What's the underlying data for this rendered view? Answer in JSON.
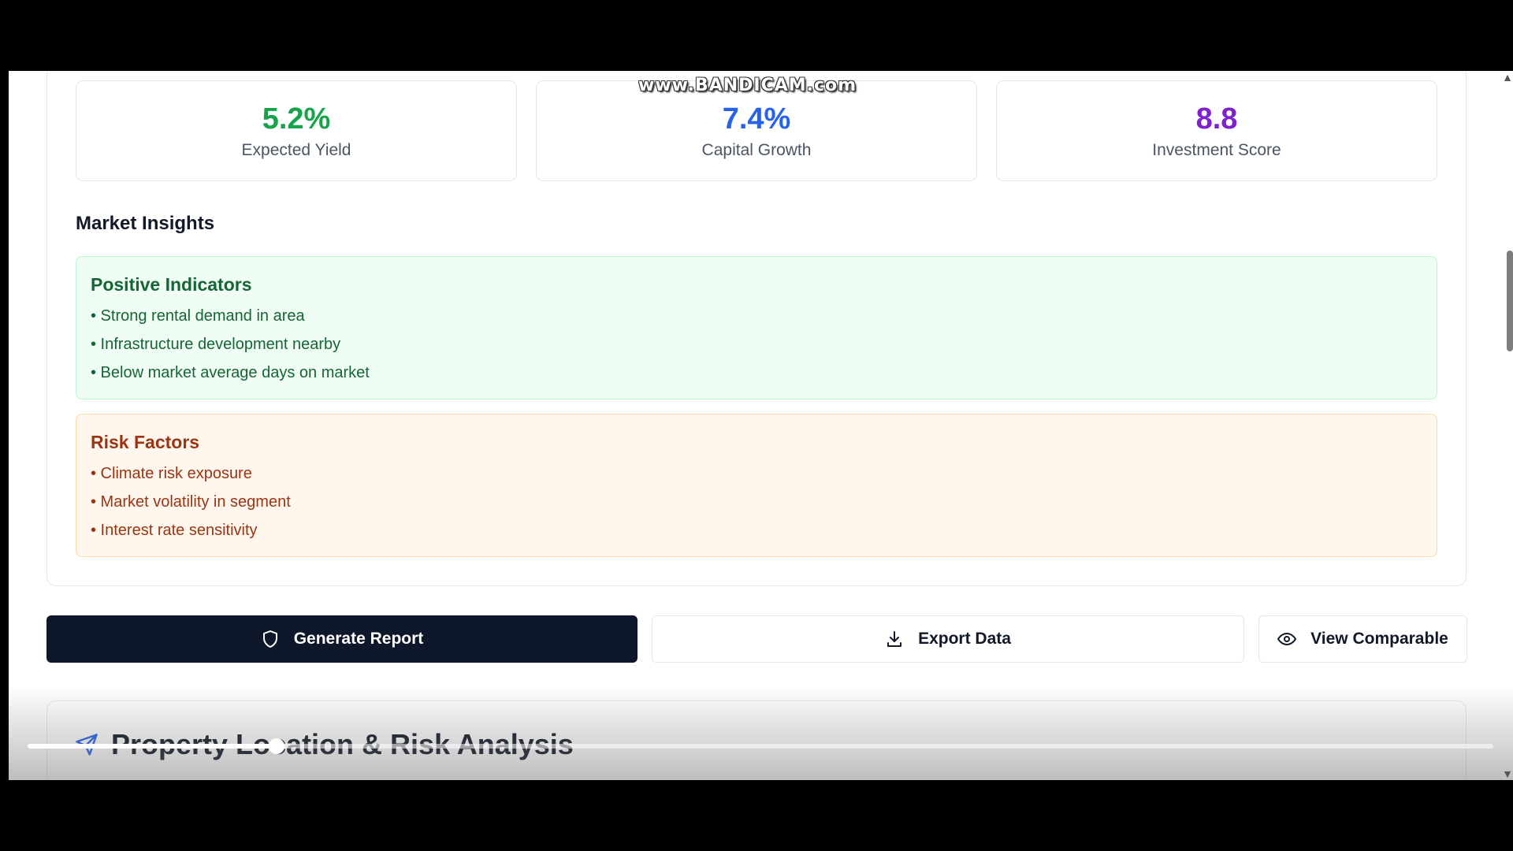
{
  "metrics": [
    {
      "value": "5.2%",
      "label": "Expected Yield",
      "color": "#16a34a"
    },
    {
      "value": "7.4%",
      "label": "Capital Growth",
      "color": "#2563eb"
    },
    {
      "value": "8.8",
      "label": "Investment Score",
      "color": "#7e22ce"
    }
  ],
  "market_insights": {
    "title": "Market Insights",
    "positive": {
      "title": "Positive Indicators",
      "items": [
        "• Strong rental demand in area",
        "• Infrastructure development nearby",
        "• Below market average days on market"
      ]
    },
    "risk": {
      "title": "Risk Factors",
      "items": [
        "• Climate risk exposure",
        "• Market volatility in segment",
        "• Interest rate sensitivity"
      ]
    }
  },
  "actions": {
    "generate_report": {
      "label": "Generate Report",
      "icon": "shield-icon"
    },
    "export_data": {
      "label": "Export Data",
      "icon": "download-icon"
    },
    "view_comparable": {
      "label": "View Comparable",
      "icon": "eye-icon"
    }
  },
  "location_section": {
    "title": "Property Location & Risk Analysis",
    "icon": "navigation-icon"
  },
  "video_player": {
    "progress": 0.17
  },
  "watermark": "www.BANDICAM.com",
  "colors": {
    "accent_dark": "#0f172a",
    "positive": "#166534",
    "risk": "#9a3412"
  }
}
